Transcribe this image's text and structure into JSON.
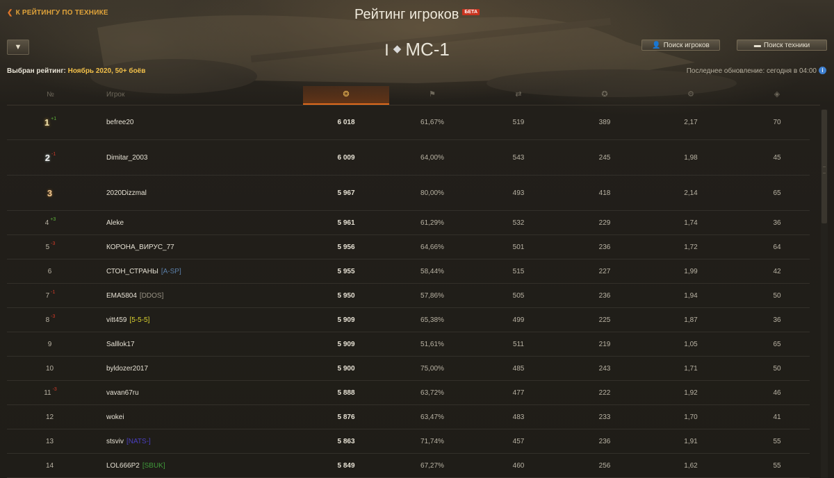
{
  "header": {
    "back_label": "К РЕЙТИНГУ ПО ТЕХНИКЕ",
    "title": "Рейтинг игроков",
    "beta_badge": "БЕТА",
    "vehicle_tier": "I",
    "vehicle_name": "МС-1",
    "search_players_label": "Поиск игроков",
    "search_tanks_label": "Поиск техники"
  },
  "filters": {
    "selected_label": "Выбран рейтинг:",
    "selected_value": "Ноябрь 2020, 50+ боёв",
    "last_update": "Последнее обновление: сегодня в 04:00"
  },
  "table": {
    "col_rank": "№",
    "col_player": "Игрок",
    "icons": [
      "rating-medal-icon",
      "flag-icon",
      "battles-icon",
      "experience-star-icon",
      "frags-icon",
      "spotted-icon"
    ],
    "rows": [
      {
        "rank": "1",
        "delta": "+1",
        "name": "befree20",
        "clan": "",
        "rating": "6 018",
        "win": "61,67%",
        "battles": "519",
        "exp": "389",
        "frags": "2,17",
        "spot": "70"
      },
      {
        "rank": "2",
        "delta": "-1",
        "name": "Dimitar_2003",
        "clan": "",
        "rating": "6 009",
        "win": "64,00%",
        "battles": "543",
        "exp": "245",
        "frags": "1,98",
        "spot": "45"
      },
      {
        "rank": "3",
        "delta": "",
        "name": "2020Dizzmal",
        "clan": "",
        "rating": "5 967",
        "win": "80,00%",
        "battles": "493",
        "exp": "418",
        "frags": "2,14",
        "spot": "65"
      },
      {
        "rank": "4",
        "delta": "+3",
        "name": "Aleke",
        "clan": "",
        "rating": "5 961",
        "win": "61,29%",
        "battles": "532",
        "exp": "229",
        "frags": "1,74",
        "spot": "36"
      },
      {
        "rank": "5",
        "delta": "-3",
        "name": "КОРОНА_ВИРУС_77",
        "clan": "",
        "rating": "5 956",
        "win": "64,66%",
        "battles": "501",
        "exp": "236",
        "frags": "1,72",
        "spot": "64"
      },
      {
        "rank": "6",
        "delta": "",
        "name": "СТОН_СТРАНЫ",
        "clan": "[A-SP]",
        "rating": "5 955",
        "win": "58,44%",
        "battles": "515",
        "exp": "227",
        "frags": "1,99",
        "spot": "42"
      },
      {
        "rank": "7",
        "delta": "-1",
        "name": "EMA5804",
        "clan": "[DDOS]",
        "rating": "5 950",
        "win": "57,86%",
        "battles": "505",
        "exp": "236",
        "frags": "1,94",
        "spot": "50"
      },
      {
        "rank": "8",
        "delta": "-3",
        "name": "vitt459",
        "clan": "[5-5-5]",
        "rating": "5 909",
        "win": "65,38%",
        "battles": "499",
        "exp": "225",
        "frags": "1,87",
        "spot": "36"
      },
      {
        "rank": "9",
        "delta": "",
        "name": "Salllok17",
        "clan": "",
        "rating": "5 909",
        "win": "51,61%",
        "battles": "511",
        "exp": "219",
        "frags": "1,05",
        "spot": "65"
      },
      {
        "rank": "10",
        "delta": "",
        "name": "byldozer2017",
        "clan": "",
        "rating": "5 900",
        "win": "75,00%",
        "battles": "485",
        "exp": "243",
        "frags": "1,71",
        "spot": "50"
      },
      {
        "rank": "11",
        "delta": "-3",
        "name": "vavan67ru",
        "clan": "",
        "rating": "5 888",
        "win": "63,72%",
        "battles": "477",
        "exp": "222",
        "frags": "1,92",
        "spot": "46"
      },
      {
        "rank": "12",
        "delta": "",
        "name": "wokei",
        "clan": "",
        "rating": "5 876",
        "win": "63,47%",
        "battles": "483",
        "exp": "233",
        "frags": "1,70",
        "spot": "41"
      },
      {
        "rank": "13",
        "delta": "",
        "name": "stsviv",
        "clan": "[NATS-]",
        "rating": "5 863",
        "win": "71,74%",
        "battles": "457",
        "exp": "236",
        "frags": "1,91",
        "spot": "55"
      },
      {
        "rank": "14",
        "delta": "",
        "name": "LOL666P2",
        "clan": "[SBUK]",
        "rating": "5 849",
        "win": "67,27%",
        "battles": "460",
        "exp": "256",
        "frags": "1,62",
        "spot": "55"
      }
    ]
  },
  "colors": {
    "accent": "#e06a1c",
    "gold_text": "#f2c04a",
    "delta_up": "#5fb83c",
    "delta_down": "#d23a28",
    "clan_colors": {
      "[A-SP]": "#5b7fa8",
      "[DDOS]": "#9a9486",
      "[5-5-5]": "#d8d030",
      "[NATS-]": "#4a3fc0",
      "[SBUK]": "#3f9a3a"
    }
  }
}
